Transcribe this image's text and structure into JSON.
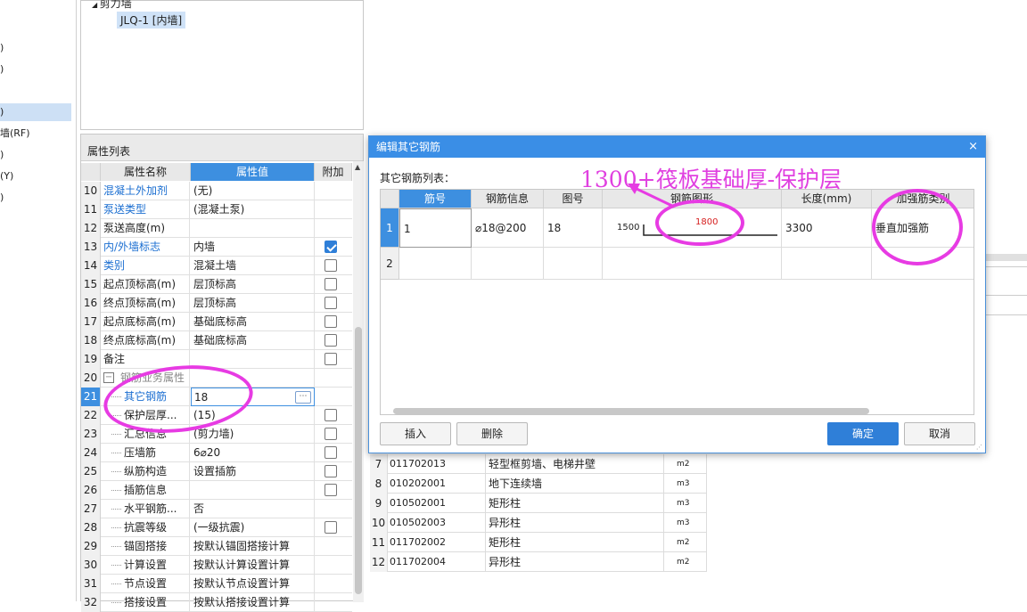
{
  "left_pane": {
    "items": [
      {
        "label": ")",
        "selected": false
      },
      {
        "label": ")",
        "selected": false
      },
      {
        "label": ")",
        "selected": true
      },
      {
        "label": "墙(RF)",
        "selected": false
      },
      {
        "label": ")",
        "selected": false
      },
      {
        "label": "(Y)",
        "selected": false
      },
      {
        "label": ")",
        "selected": false
      }
    ]
  },
  "tree": {
    "root_label": "剪力墙",
    "child_label": "JLQ-1 [内墙]"
  },
  "properties": {
    "title": "属性列表",
    "headers": {
      "name": "属性名称",
      "value": "属性值",
      "extra": "附加"
    },
    "rows": [
      {
        "num": "10",
        "name": "混凝土外加剂",
        "value": "(无)",
        "blue": true,
        "indent": false,
        "checkbox": "none"
      },
      {
        "num": "11",
        "name": "泵送类型",
        "value": "(混凝土泵)",
        "blue": true,
        "indent": false,
        "checkbox": "none"
      },
      {
        "num": "12",
        "name": "泵送高度(m)",
        "value": "",
        "blue": false,
        "indent": false,
        "checkbox": "none"
      },
      {
        "num": "13",
        "name": "内/外墙标志",
        "value": "内墙",
        "blue": true,
        "indent": false,
        "checkbox": "on"
      },
      {
        "num": "14",
        "name": "类别",
        "value": "混凝土墙",
        "blue": true,
        "indent": false,
        "checkbox": "off"
      },
      {
        "num": "15",
        "name": "起点顶标高(m)",
        "value": "层顶标高",
        "blue": false,
        "indent": false,
        "checkbox": "off"
      },
      {
        "num": "16",
        "name": "终点顶标高(m)",
        "value": "层顶标高",
        "blue": false,
        "indent": false,
        "checkbox": "off"
      },
      {
        "num": "17",
        "name": "起点底标高(m)",
        "value": "基础底标高",
        "blue": false,
        "indent": false,
        "checkbox": "off"
      },
      {
        "num": "18",
        "name": "终点底标高(m)",
        "value": "基础底标高",
        "blue": false,
        "indent": false,
        "checkbox": "off"
      },
      {
        "num": "19",
        "name": "备注",
        "value": "",
        "blue": false,
        "indent": false,
        "checkbox": "off"
      },
      {
        "num": "20",
        "name": "钢筋业务属性",
        "value": "",
        "blue": false,
        "indent": false,
        "checkbox": "none",
        "group": true
      },
      {
        "num": "21",
        "name": "其它钢筋",
        "value": "18",
        "blue": true,
        "indent": true,
        "checkbox": "none",
        "selected": true
      },
      {
        "num": "22",
        "name": "保护层厚...",
        "value": "(15)",
        "blue": false,
        "indent": true,
        "checkbox": "off"
      },
      {
        "num": "23",
        "name": "汇总信息",
        "value": "(剪力墙)",
        "blue": false,
        "indent": true,
        "checkbox": "off"
      },
      {
        "num": "24",
        "name": "压墙筋",
        "value": "6⌀20",
        "blue": false,
        "indent": true,
        "checkbox": "off"
      },
      {
        "num": "25",
        "name": "纵筋构造",
        "value": "设置插筋",
        "blue": false,
        "indent": true,
        "checkbox": "off"
      },
      {
        "num": "26",
        "name": "插筋信息",
        "value": "",
        "blue": false,
        "indent": true,
        "checkbox": "off"
      },
      {
        "num": "27",
        "name": "水平钢筋...",
        "value": "否",
        "blue": false,
        "indent": true,
        "checkbox": "none"
      },
      {
        "num": "28",
        "name": "抗震等级",
        "value": "(一级抗震)",
        "blue": false,
        "indent": true,
        "checkbox": "off"
      },
      {
        "num": "29",
        "name": "锚固搭接",
        "value": "按默认锚固搭接计算",
        "blue": false,
        "indent": true,
        "checkbox": "none"
      },
      {
        "num": "30",
        "name": "计算设置",
        "value": "按默认计算设置计算",
        "blue": false,
        "indent": true,
        "checkbox": "none"
      },
      {
        "num": "31",
        "name": "节点设置",
        "value": "按默认节点设置计算",
        "blue": false,
        "indent": true,
        "checkbox": "none"
      },
      {
        "num": "32",
        "name": "搭接设置",
        "value": "按默认搭接设置计算",
        "blue": false,
        "indent": true,
        "checkbox": "none"
      }
    ]
  },
  "bg_table": {
    "rows": [
      {
        "num": "7",
        "code": "011702013",
        "name": "轻型框剪墙、电梯井壁",
        "unit": "m2"
      },
      {
        "num": "8",
        "code": "010202001",
        "name": "地下连续墙",
        "unit": "m3"
      },
      {
        "num": "9",
        "code": "010502001",
        "name": "矩形柱",
        "unit": "m3"
      },
      {
        "num": "10",
        "code": "010502003",
        "name": "异形柱",
        "unit": "m3"
      },
      {
        "num": "11",
        "code": "011702002",
        "name": "矩形柱",
        "unit": "m2"
      },
      {
        "num": "12",
        "code": "011702004",
        "name": "异形柱",
        "unit": "m2"
      }
    ]
  },
  "dialog": {
    "title": "编辑其它钢筋",
    "close": "×",
    "list_label": "其它钢筋列表：",
    "headers": [
      "筋号",
      "钢筋信息",
      "图号",
      "钢筋图形",
      "长度(mm)",
      "加强筋类别"
    ],
    "rows": [
      {
        "num": "1",
        "bar_no": "1",
        "info": "⌀18@200",
        "fig_no": "18",
        "shape_left": "1500",
        "shape_mid": "1800",
        "length": "3300",
        "type": "垂直加强筋"
      },
      {
        "num": "2",
        "bar_no": "",
        "info": "",
        "fig_no": "",
        "shape_left": "",
        "shape_mid": "",
        "length": "",
        "type": ""
      }
    ],
    "buttons": {
      "insert": "插入",
      "delete": "删除",
      "ok": "确定",
      "cancel": "取消"
    }
  },
  "annotation": {
    "text": "1300+筏板基础厚-保护层",
    "color": "#e040e0"
  },
  "colors": {
    "accent": "#3a8ee6",
    "annotation": "#e73be3",
    "shape_text": "#d62020"
  }
}
